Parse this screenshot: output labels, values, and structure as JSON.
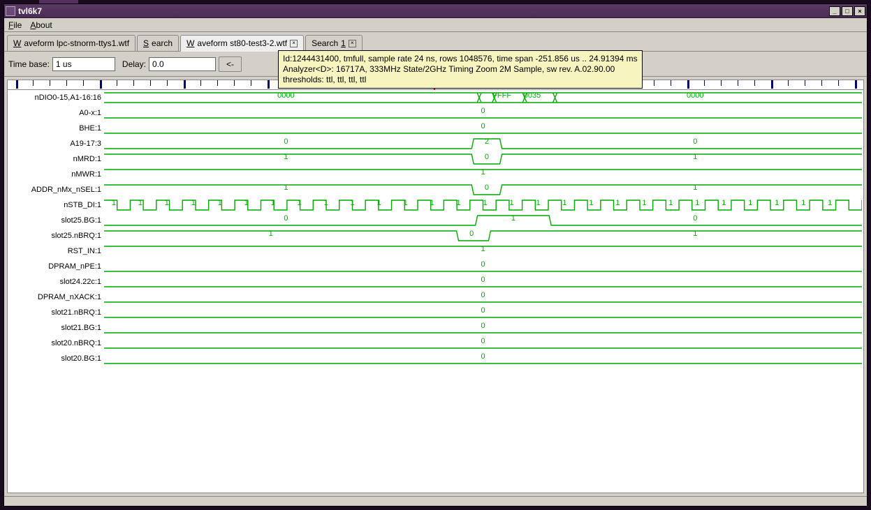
{
  "window": {
    "title": "tvl6k7"
  },
  "menus": {
    "file": "File",
    "about": "About"
  },
  "tabs": [
    {
      "label": "Waveform lpc-stnorm-ttys1.wtf",
      "closable": false
    },
    {
      "label": "Search",
      "closable": false
    },
    {
      "label": "Waveform st80-test3-2.wtf",
      "closable": true,
      "active": true
    },
    {
      "label": "Search 1",
      "closable": true
    }
  ],
  "toolbar": {
    "timebase_label": "Time base:",
    "timebase_value": "1 us",
    "delay_label": "Delay:",
    "delay_value": "0.0",
    "back_label": "<-"
  },
  "tooltip": {
    "line1": "Id:1244431400, tmfull, sample rate 24 ns, rows 1048576, time span -251.856 us .. 24.91394 ms",
    "line2": "Analyzer<D>: 16717A, 333MHz State/2GHz Timing Zoom 2M Sample, sw rev. A.02.90.00",
    "line3": "thresholds: ttl, ttl, ttl, ttl"
  },
  "ruler": {
    "cursor_x_pct": 49.8
  },
  "signals": [
    {
      "name": "nDIO0-15,A1-16:16",
      "type": "bus",
      "values": [
        {
          "x_pct": 24,
          "text": "0000"
        },
        {
          "x_pct": 52.5,
          "text": "FFFF"
        },
        {
          "x_pct": 56.5,
          "text": "0035"
        },
        {
          "x_pct": 78,
          "text": "0000"
        }
      ]
    },
    {
      "name": "A0-x:1",
      "type": "low",
      "values": [
        {
          "x_pct": 50,
          "text": "0"
        }
      ]
    },
    {
      "name": "BHE:1",
      "type": "low",
      "values": [
        {
          "x_pct": 50,
          "text": "0"
        }
      ]
    },
    {
      "name": "A19-17:3",
      "type": "pulse",
      "values": [
        {
          "x_pct": 24,
          "text": "0"
        },
        {
          "x_pct": 50.5,
          "text": "2"
        },
        {
          "x_pct": 78,
          "text": "0"
        }
      ]
    },
    {
      "name": "nMRD:1",
      "type": "notch",
      "values": [
        {
          "x_pct": 24,
          "text": "1"
        },
        {
          "x_pct": 50.5,
          "text": "0"
        },
        {
          "x_pct": 78,
          "text": "1"
        }
      ]
    },
    {
      "name": "nMWR:1",
      "type": "high",
      "values": [
        {
          "x_pct": 50,
          "text": "1"
        }
      ]
    },
    {
      "name": "ADDR_nMx_nSEL:1",
      "type": "notch",
      "values": [
        {
          "x_pct": 24,
          "text": "1"
        },
        {
          "x_pct": 50.5,
          "text": "0"
        },
        {
          "x_pct": 78,
          "text": "1"
        }
      ]
    },
    {
      "name": "nSTB_DI:1",
      "type": "clock",
      "values": []
    },
    {
      "name": "slot25.BG:1",
      "type": "pulse-wide",
      "values": [
        {
          "x_pct": 24,
          "text": "0"
        },
        {
          "x_pct": 54,
          "text": "1"
        },
        {
          "x_pct": 78,
          "text": "0"
        }
      ]
    },
    {
      "name": "slot25.nBRQ:1",
      "type": "notch-narrow",
      "values": [
        {
          "x_pct": 22,
          "text": "1"
        },
        {
          "x_pct": 48.5,
          "text": "0"
        },
        {
          "x_pct": 78,
          "text": "1"
        }
      ]
    },
    {
      "name": "RST_IN:1",
      "type": "high",
      "values": [
        {
          "x_pct": 50,
          "text": "1"
        }
      ]
    },
    {
      "name": "DPRAM_nPE:1",
      "type": "low",
      "values": [
        {
          "x_pct": 50,
          "text": "0"
        }
      ]
    },
    {
      "name": "slot24.22c:1",
      "type": "low",
      "values": [
        {
          "x_pct": 50,
          "text": "0"
        }
      ]
    },
    {
      "name": "DPRAM_nXACK:1",
      "type": "low",
      "values": [
        {
          "x_pct": 50,
          "text": "0"
        }
      ]
    },
    {
      "name": "slot21.nBRQ:1",
      "type": "low",
      "values": [
        {
          "x_pct": 50,
          "text": "0"
        }
      ]
    },
    {
      "name": "slot21.BG:1",
      "type": "low",
      "values": [
        {
          "x_pct": 50,
          "text": "0"
        }
      ]
    },
    {
      "name": "slot20.nBRQ:1",
      "type": "low",
      "values": [
        {
          "x_pct": 50,
          "text": "0"
        }
      ]
    },
    {
      "name": "slot20.BG:1",
      "type": "low",
      "values": [
        {
          "x_pct": 50,
          "text": "0"
        }
      ]
    }
  ],
  "colors": {
    "wave": "#0a0",
    "accent": "#0a0"
  }
}
